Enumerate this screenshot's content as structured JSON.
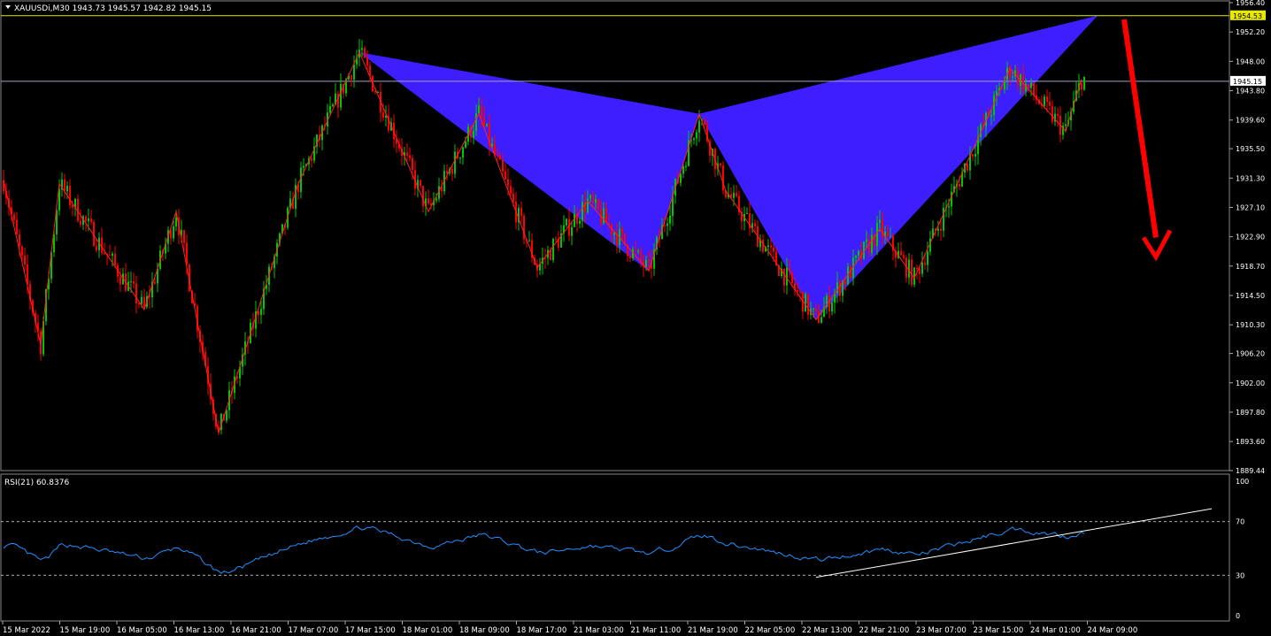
{
  "header": {
    "symbol_line": "XAUUSDi,M30  1943.73 1945.57 1942.82 1945.15"
  },
  "rsi_label": "RSI(21) 60.8376",
  "price_tags": {
    "top": "1954.53",
    "current": "1945.15"
  },
  "colors": {
    "background": "#000000",
    "bull_candle": "#00c800",
    "bear_candle": "#ff0000",
    "pattern_fill": "#3c1eff",
    "zigzag": "#ff2020",
    "rsi_line": "#1e90ff",
    "rsi_trendline": "#ffffff",
    "arrow": "#ff0000",
    "top_line": "#e8e800",
    "current_line": "#a0a0c8"
  },
  "chart_data": [
    {
      "type": "candlestick",
      "symbol": "XAUUSDi",
      "timeframe": "M30",
      "ylim": [
        1889.44,
        1956.4
      ],
      "y_ticks": [
        "1956.40",
        "1952.20",
        "1948.00",
        "1943.80",
        "1939.60",
        "1935.50",
        "1931.30",
        "1927.10",
        "1922.90",
        "1918.70",
        "1914.50",
        "1910.30",
        "1906.20",
        "1902.00",
        "1897.80",
        "1893.60",
        "1889.44"
      ],
      "x_ticks": [
        "15 Mar 2022",
        "15 Mar 19:00",
        "16 Mar 05:00",
        "16 Mar 13:00",
        "16 Mar 21:00",
        "17 Mar 07:00",
        "17 Mar 15:00",
        "18 Mar 01:00",
        "18 Mar 09:00",
        "18 Mar 17:00",
        "21 Mar 03:00",
        "21 Mar 11:00",
        "21 Mar 19:00",
        "22 Mar 05:00",
        "22 Mar 13:00",
        "22 Mar 21:00",
        "23 Mar 07:00",
        "23 Mar 15:00",
        "24 Mar 01:00",
        "24 Mar 09:00"
      ],
      "current_price": 1945.15,
      "top_level": 1954.53,
      "zigzag": [
        {
          "i": 0,
          "price": 1931.0
        },
        {
          "i": 14,
          "price": 1907.5
        },
        {
          "i": 21,
          "price": 1930.5
        },
        {
          "i": 36,
          "price": 1922.0
        },
        {
          "i": 53,
          "price": 1912.5
        },
        {
          "i": 65,
          "price": 1926.5
        },
        {
          "i": 81,
          "price": 1894.8
        },
        {
          "i": 111,
          "price": 1930.5
        },
        {
          "i": 134,
          "price": 1949.3
        },
        {
          "i": 160,
          "price": 1926.5
        },
        {
          "i": 179,
          "price": 1940.5
        },
        {
          "i": 201,
          "price": 1918.5
        },
        {
          "i": 220,
          "price": 1928.0
        },
        {
          "i": 243,
          "price": 1918.0
        },
        {
          "i": 262,
          "price": 1940.5
        },
        {
          "i": 272,
          "price": 1929.5
        },
        {
          "i": 306,
          "price": 1911.0
        },
        {
          "i": 330,
          "price": 1924.0
        },
        {
          "i": 343,
          "price": 1917.0
        },
        {
          "i": 379,
          "price": 1947.0
        },
        {
          "i": 400,
          "price": 1938.0
        },
        {
          "i": 406,
          "price": 1945.5
        }
      ],
      "pattern": {
        "X": {
          "i": 134,
          "price": 1949.3
        },
        "A": {
          "i": 243,
          "price": 1918.0
        },
        "B": {
          "i": 262,
          "price": 1940.5
        },
        "C": {
          "i": 306,
          "price": 1911.0
        },
        "D": {
          "i": 412,
          "price": 1954.53
        }
      },
      "arrow": {
        "from": {
          "i": 422,
          "price": 1954.0
        },
        "to": {
          "i": 434,
          "price": 1920.0
        },
        "direction": "down"
      }
    },
    {
      "type": "line",
      "indicator": "RSI(21)",
      "value": 60.8376,
      "ylim": [
        0,
        100
      ],
      "y_ticks": [
        "100",
        "70",
        "30",
        "0"
      ],
      "levels": [
        70,
        30
      ],
      "trendline": {
        "from": {
          "i": 306,
          "value": 28.5
        },
        "to": {
          "i": 455,
          "value": 79.5
        }
      }
    }
  ]
}
